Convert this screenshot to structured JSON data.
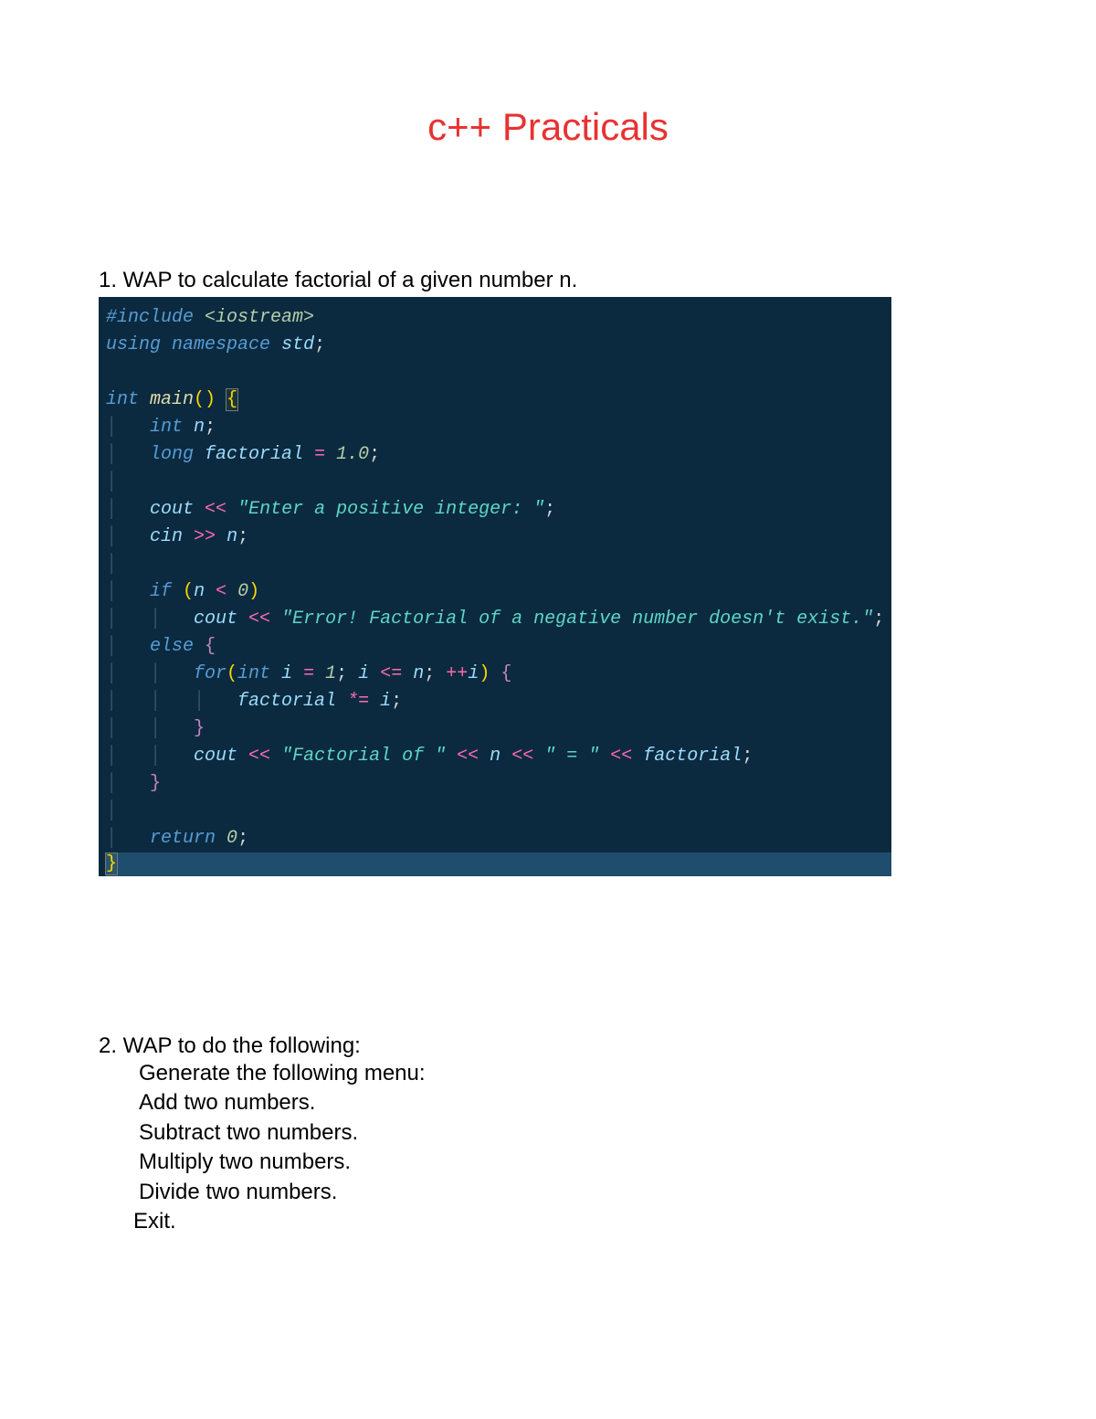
{
  "title": "c++ Practicals",
  "question1": "1. WAP to calculate factorial of a given number n.",
  "code": {
    "l1_include": "#include",
    "l1_header": "<iostream>",
    "l2_using": "using",
    "l2_namespace": "namespace",
    "l2_std": "std",
    "l4_int": "int",
    "l4_main": "main",
    "l5_int": "int",
    "l5_n": "n",
    "l6_long": "long",
    "l6_factorial": "factorial",
    "l6_val": "1.0",
    "l8_cout": "cout",
    "l8_str": "\"Enter a positive integer: \"",
    "l9_cin": "cin",
    "l9_n": "n",
    "l11_if": "if",
    "l11_n": "n",
    "l11_zero": "0",
    "l12_cout": "cout",
    "l12_str": "\"Error! Factorial of a negative number doesn't exist.\"",
    "l13_else": "else",
    "l14_for": "for",
    "l14_int": "int",
    "l14_i": "i",
    "l14_one": "1",
    "l14_n": "n",
    "l14_ii": "i",
    "l15_factorial": "factorial",
    "l15_i": "i",
    "l17_cout": "cout",
    "l17_str1": "\"Factorial of \"",
    "l17_n": "n",
    "l17_str2": "\" = \"",
    "l17_factorial": "factorial",
    "l20_return": "return",
    "l20_zero": "0"
  },
  "question2": {
    "line1": "2. WAP to do the following:",
    "line2": "Generate the following menu:",
    "line3": "Add two numbers.",
    "line4": "Subtract two numbers.",
    "line5": "Multiply two numbers.",
    "line6": "Divide two numbers.",
    "line7": "Exit."
  }
}
